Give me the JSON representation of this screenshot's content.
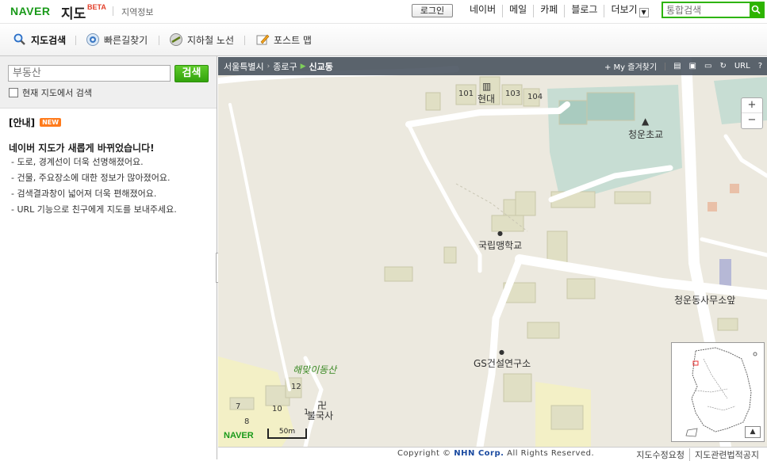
{
  "header": {
    "logo": "NAVER",
    "service": "지도",
    "beta": "BETA",
    "subtitle": "지역정보",
    "login_label": "로그인",
    "nav": [
      "네이버",
      "메일",
      "카페",
      "블로그",
      "더보기"
    ],
    "search_placeholder": "통합검색",
    "icons": {
      "search": "search-icon",
      "more": "chevron-down-icon"
    },
    "brand_color": "#2db400"
  },
  "tabs": [
    {
      "label": "지도검색",
      "icon": "magnifier-icon",
      "active": true
    },
    {
      "label": "빠른길찾기",
      "icon": "route-icon",
      "active": false
    },
    {
      "label": "지하철 노선",
      "icon": "subway-icon",
      "active": false
    },
    {
      "label": "포스트 맵",
      "icon": "post-map-icon",
      "active": false
    }
  ],
  "left_panel": {
    "search_value": "부동산",
    "search_button": "검색",
    "checkbox_label": "현재 지도에서 검색",
    "checkbox_checked": false,
    "notice_title": "[안내]",
    "notice_badge": "NEW",
    "notice_heading": "네이버 지도가 새롭게 바뀌었습니다!",
    "notice_items": [
      "- 도로, 경계선이 더욱 선명해졌어요.",
      "- 건물, 주요장소에 대한 정보가 많아졌어요.",
      "- 검색결과창이 넓어져 더욱 편해졌어요.",
      "- URL 기능으로 친구에게 지도를 보내주세요."
    ]
  },
  "map": {
    "breadcrumb": [
      "서울특별시",
      "종로구",
      "신교동"
    ],
    "tools": [
      "+ My 즐겨찾기",
      "print-icon",
      "save-icon",
      "ruler-icon",
      "refresh-icon",
      "URL",
      "?"
    ],
    "zoom": {
      "in": "+",
      "out": "−"
    },
    "labels": {
      "hyundai": "현대",
      "school_cheongun": "청운초교",
      "school_blind": "국립맹학교",
      "office": "청운동사무소앞",
      "gs": "GS건설연구소",
      "mountain": "해맞이동산",
      "temple": "불국사"
    },
    "building_numbers": [
      "101",
      "103",
      "104",
      "12",
      "10",
      "8",
      "7",
      "1"
    ],
    "logo": "NAVER",
    "scale": "50m"
  },
  "footer": {
    "copyright_pre": "Copyright ©",
    "company": "NHN Corp.",
    "copyright_post": "All Rights Reserved.",
    "links": [
      "지도수정요청",
      "지도관련법적공지"
    ]
  }
}
